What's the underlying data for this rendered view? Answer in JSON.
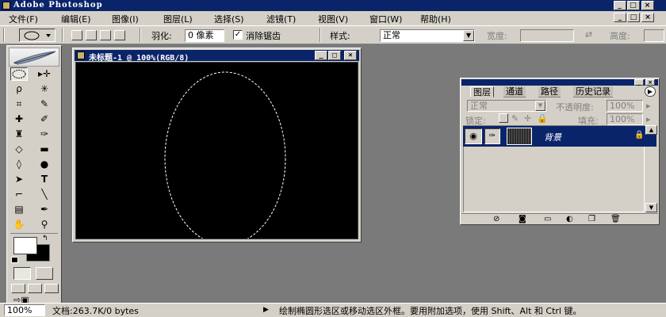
{
  "window": {
    "title": "Adobe Photoshop"
  },
  "menu": [
    {
      "label": "文件(F)"
    },
    {
      "label": "编辑(E)"
    },
    {
      "label": "图像(I)"
    },
    {
      "label": "图层(L)"
    },
    {
      "label": "选择(S)"
    },
    {
      "label": "滤镜(T)"
    },
    {
      "label": "视图(V)"
    },
    {
      "label": "窗口(W)"
    },
    {
      "label": "帮助(H)"
    }
  ],
  "options": {
    "feather_label": "羽化:",
    "feather_value": "0 像素",
    "antialias_checked": true,
    "antialias_label": "消除锯齿",
    "style_label": "样式:",
    "style_value": "正常",
    "width_label": "宽度:",
    "height_label": "高度:"
  },
  "document": {
    "title": "未标题-1 @ 100%(RGB/8)"
  },
  "layers_palette": {
    "tabs": [
      "图层",
      "通道",
      "路径",
      "历史记录"
    ],
    "active_tab": "图层",
    "blend_mode": "正常",
    "opacity_label": "不透明度:",
    "opacity_value": "100%",
    "lock_label": "锁定:",
    "fill_label": "填充:",
    "fill_value": "100%",
    "layers": [
      {
        "name": "背景",
        "locked": true,
        "selected": true
      }
    ]
  },
  "status": {
    "zoom": "100%",
    "doc_info": "文档:263.7K/0 bytes",
    "hint": "绘制椭圆形选区或移动选区外框。要用附加选项，使用 Shift、Alt 和 Ctrl 键。"
  },
  "colors": {
    "title_bar": "#0a246a",
    "chrome": "#d4d0c8",
    "workspace": "#7a7a7a",
    "canvas": "#000000",
    "foreground_swatch": "#ffffff",
    "background_swatch": "#000000"
  }
}
